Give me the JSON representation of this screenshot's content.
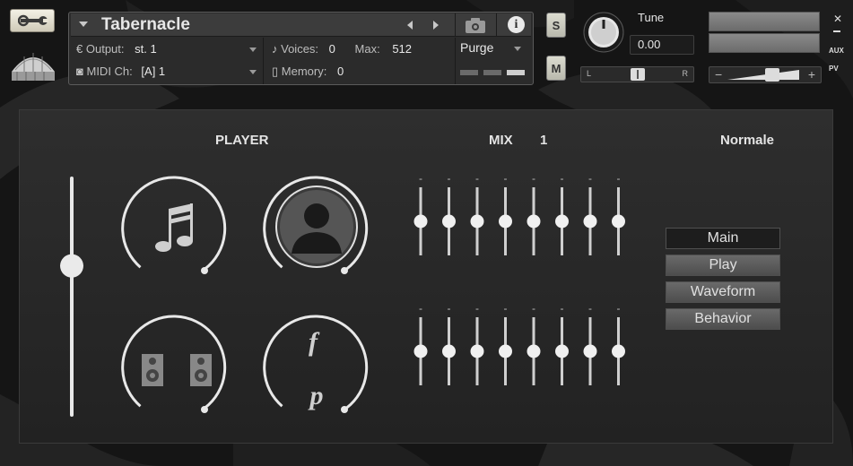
{
  "header": {
    "instrument_name": "Tabernacle",
    "output_label": "Output:",
    "output_value": "st. 1",
    "voices_label": "Voices:",
    "voices_value": "0",
    "max_label": "Max:",
    "max_value": "512",
    "midi_label": "MIDI Ch:",
    "midi_value": "[A]  1",
    "memory_label": "Memory:",
    "memory_value": "0",
    "purge_label": "Purge",
    "solo_label": "S",
    "mute_label": "M",
    "tune_label": "Tune",
    "tune_value": "0.00",
    "pan_left": "L",
    "pan_right": "R",
    "aux_label": "AUX",
    "pv_label": "PV"
  },
  "main": {
    "player_title": "PLAYER",
    "mix_title": "MIX",
    "mix_number": "1",
    "articulation": "Normale",
    "master_slider_level": 0.63,
    "knobs": [
      {
        "name": "music-notes"
      },
      {
        "name": "person"
      },
      {
        "name": "speakers"
      },
      {
        "name": "dynamics",
        "top_glyph": "f",
        "bottom_glyph": "p"
      }
    ],
    "mix_bank_top": [
      0.5,
      0.5,
      0.5,
      0.5,
      0.5,
      0.5,
      0.5,
      0.5
    ],
    "mix_bank_bottom": [
      0.5,
      0.5,
      0.5,
      0.5,
      0.5,
      0.5,
      0.5,
      0.5
    ],
    "mix_marker": "-",
    "menu": [
      "Main",
      "Play",
      "Waveform",
      "Behavior"
    ]
  },
  "colors": {
    "panel": "#2a2a2a",
    "accent": "#e8e8e8"
  }
}
